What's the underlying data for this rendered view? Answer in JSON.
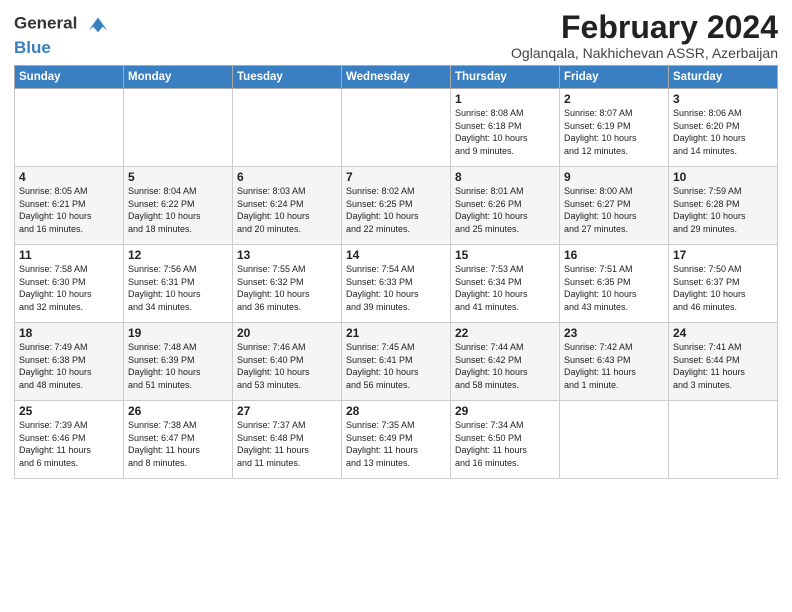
{
  "app": {
    "logo_general": "General",
    "logo_blue": "Blue",
    "title": "February 2024",
    "subtitle": "Oglanqala, Nakhichevan ASSR, Azerbaijan"
  },
  "days_of_week": [
    "Sunday",
    "Monday",
    "Tuesday",
    "Wednesday",
    "Thursday",
    "Friday",
    "Saturday"
  ],
  "weeks": [
    [
      {
        "day": "",
        "info": ""
      },
      {
        "day": "",
        "info": ""
      },
      {
        "day": "",
        "info": ""
      },
      {
        "day": "",
        "info": ""
      },
      {
        "day": "1",
        "info": "Sunrise: 8:08 AM\nSunset: 6:18 PM\nDaylight: 10 hours\nand 9 minutes."
      },
      {
        "day": "2",
        "info": "Sunrise: 8:07 AM\nSunset: 6:19 PM\nDaylight: 10 hours\nand 12 minutes."
      },
      {
        "day": "3",
        "info": "Sunrise: 8:06 AM\nSunset: 6:20 PM\nDaylight: 10 hours\nand 14 minutes."
      }
    ],
    [
      {
        "day": "4",
        "info": "Sunrise: 8:05 AM\nSunset: 6:21 PM\nDaylight: 10 hours\nand 16 minutes."
      },
      {
        "day": "5",
        "info": "Sunrise: 8:04 AM\nSunset: 6:22 PM\nDaylight: 10 hours\nand 18 minutes."
      },
      {
        "day": "6",
        "info": "Sunrise: 8:03 AM\nSunset: 6:24 PM\nDaylight: 10 hours\nand 20 minutes."
      },
      {
        "day": "7",
        "info": "Sunrise: 8:02 AM\nSunset: 6:25 PM\nDaylight: 10 hours\nand 22 minutes."
      },
      {
        "day": "8",
        "info": "Sunrise: 8:01 AM\nSunset: 6:26 PM\nDaylight: 10 hours\nand 25 minutes."
      },
      {
        "day": "9",
        "info": "Sunrise: 8:00 AM\nSunset: 6:27 PM\nDaylight: 10 hours\nand 27 minutes."
      },
      {
        "day": "10",
        "info": "Sunrise: 7:59 AM\nSunset: 6:28 PM\nDaylight: 10 hours\nand 29 minutes."
      }
    ],
    [
      {
        "day": "11",
        "info": "Sunrise: 7:58 AM\nSunset: 6:30 PM\nDaylight: 10 hours\nand 32 minutes."
      },
      {
        "day": "12",
        "info": "Sunrise: 7:56 AM\nSunset: 6:31 PM\nDaylight: 10 hours\nand 34 minutes."
      },
      {
        "day": "13",
        "info": "Sunrise: 7:55 AM\nSunset: 6:32 PM\nDaylight: 10 hours\nand 36 minutes."
      },
      {
        "day": "14",
        "info": "Sunrise: 7:54 AM\nSunset: 6:33 PM\nDaylight: 10 hours\nand 39 minutes."
      },
      {
        "day": "15",
        "info": "Sunrise: 7:53 AM\nSunset: 6:34 PM\nDaylight: 10 hours\nand 41 minutes."
      },
      {
        "day": "16",
        "info": "Sunrise: 7:51 AM\nSunset: 6:35 PM\nDaylight: 10 hours\nand 43 minutes."
      },
      {
        "day": "17",
        "info": "Sunrise: 7:50 AM\nSunset: 6:37 PM\nDaylight: 10 hours\nand 46 minutes."
      }
    ],
    [
      {
        "day": "18",
        "info": "Sunrise: 7:49 AM\nSunset: 6:38 PM\nDaylight: 10 hours\nand 48 minutes."
      },
      {
        "day": "19",
        "info": "Sunrise: 7:48 AM\nSunset: 6:39 PM\nDaylight: 10 hours\nand 51 minutes."
      },
      {
        "day": "20",
        "info": "Sunrise: 7:46 AM\nSunset: 6:40 PM\nDaylight: 10 hours\nand 53 minutes."
      },
      {
        "day": "21",
        "info": "Sunrise: 7:45 AM\nSunset: 6:41 PM\nDaylight: 10 hours\nand 56 minutes."
      },
      {
        "day": "22",
        "info": "Sunrise: 7:44 AM\nSunset: 6:42 PM\nDaylight: 10 hours\nand 58 minutes."
      },
      {
        "day": "23",
        "info": "Sunrise: 7:42 AM\nSunset: 6:43 PM\nDaylight: 11 hours\nand 1 minute."
      },
      {
        "day": "24",
        "info": "Sunrise: 7:41 AM\nSunset: 6:44 PM\nDaylight: 11 hours\nand 3 minutes."
      }
    ],
    [
      {
        "day": "25",
        "info": "Sunrise: 7:39 AM\nSunset: 6:46 PM\nDaylight: 11 hours\nand 6 minutes."
      },
      {
        "day": "26",
        "info": "Sunrise: 7:38 AM\nSunset: 6:47 PM\nDaylight: 11 hours\nand 8 minutes."
      },
      {
        "day": "27",
        "info": "Sunrise: 7:37 AM\nSunset: 6:48 PM\nDaylight: 11 hours\nand 11 minutes."
      },
      {
        "day": "28",
        "info": "Sunrise: 7:35 AM\nSunset: 6:49 PM\nDaylight: 11 hours\nand 13 minutes."
      },
      {
        "day": "29",
        "info": "Sunrise: 7:34 AM\nSunset: 6:50 PM\nDaylight: 11 hours\nand 16 minutes."
      },
      {
        "day": "",
        "info": ""
      },
      {
        "day": "",
        "info": ""
      }
    ]
  ]
}
